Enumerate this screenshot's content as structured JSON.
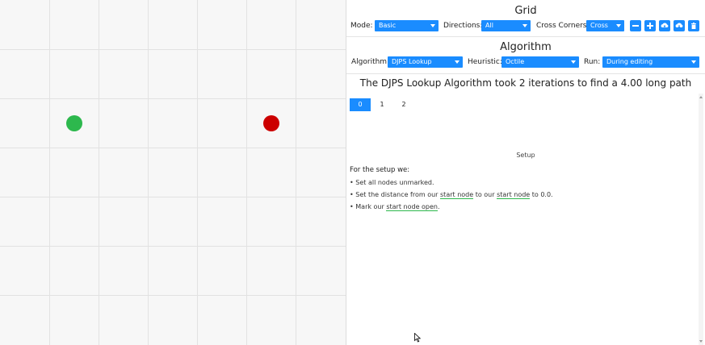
{
  "grid": {
    "start_color": "#2db84d",
    "end_color": "#cc0000"
  },
  "grid_settings": {
    "title": "Grid",
    "mode_label": "Mode:",
    "mode_value": "Basic",
    "directions_label": "Directions:",
    "directions_value": "All",
    "cross_corners_label": "Cross Corners:",
    "cross_corners_value": "Cross",
    "buttons": [
      "minus-icon",
      "plus-icon",
      "upload-icon",
      "download-icon",
      "trash-icon"
    ]
  },
  "algorithm_settings": {
    "title": "Algorithm",
    "algorithm_label": "Algorithm:",
    "algorithm_value": "DJPS Lookup",
    "heuristic_label": "Heuristic:",
    "heuristic_value": "Octile",
    "run_label": "Run:",
    "run_value": "During editing"
  },
  "result": {
    "summary": "The DJPS Lookup Algorithm took 2 iterations to find a 4.00 long path",
    "steps": [
      "0",
      "1",
      "2"
    ],
    "active_step": "0"
  },
  "setup": {
    "title": "Setup",
    "intro": "For the setup we:",
    "b1": "Set all nodes unmarked.",
    "b2_pre": "Set the distance from our ",
    "b2_link1": "start node",
    "b2_mid": " to our ",
    "b2_link2": "start node",
    "b2_post": " to 0.0.",
    "b3_pre": "Mark our ",
    "b3_link": "start node open",
    "b3_post": "."
  },
  "colors": {
    "accent": "#1a8cff",
    "link_underline": "#2db84d"
  }
}
